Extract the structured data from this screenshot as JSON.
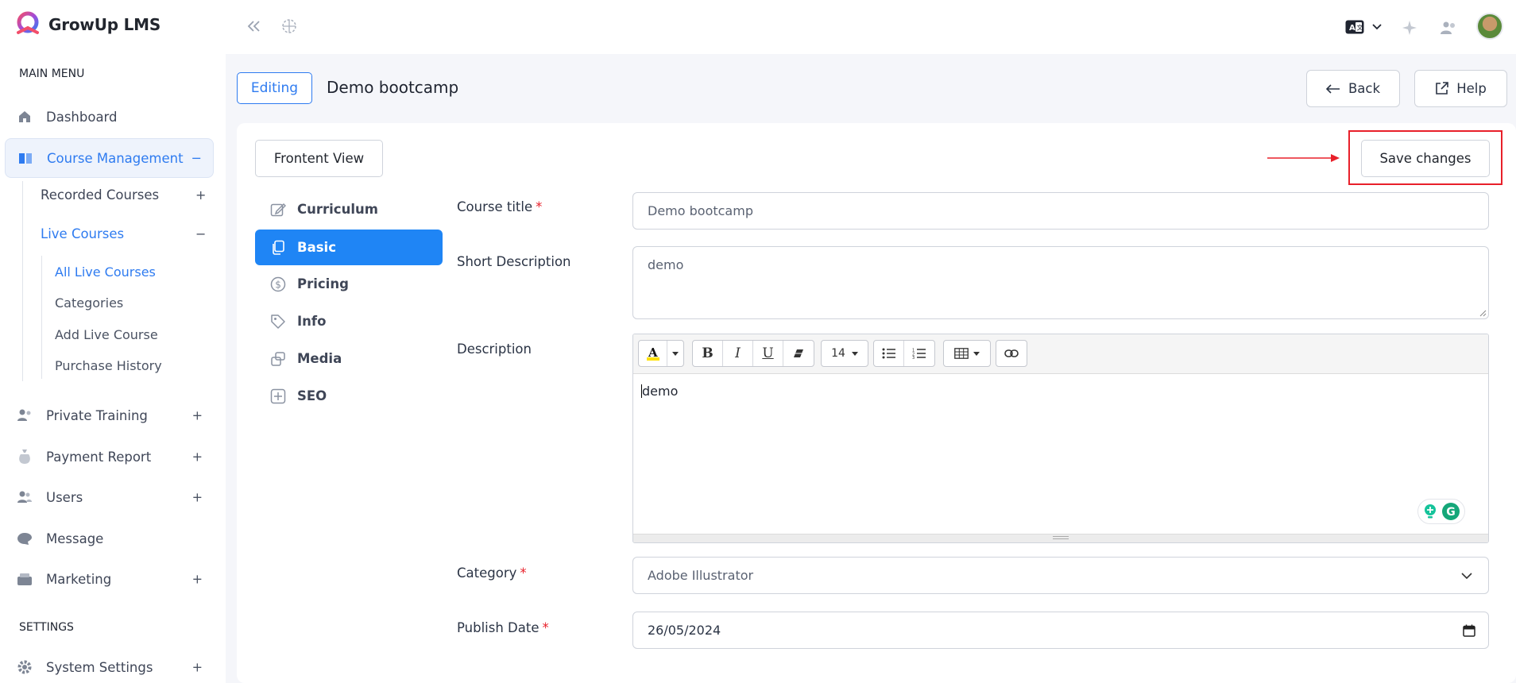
{
  "app": {
    "name": "GrowUp LMS"
  },
  "sidebar": {
    "main_menu_heading": "MAIN MENU",
    "settings_heading": "SETTINGS",
    "items": {
      "dashboard": {
        "label": "Dashboard"
      },
      "course_management": {
        "label": "Course Management",
        "toggle": "−"
      },
      "recorded_courses": {
        "label": "Recorded Courses",
        "toggle": "+"
      },
      "live_courses": {
        "label": "Live Courses",
        "toggle": "−"
      },
      "all_live_courses": {
        "label": "All Live Courses"
      },
      "categories": {
        "label": "Categories"
      },
      "add_live_course": {
        "label": "Add Live Course"
      },
      "purchase_history": {
        "label": "Purchase History"
      },
      "private_training": {
        "label": "Private Training",
        "toggle": "+"
      },
      "payment_report": {
        "label": "Payment Report",
        "toggle": "+"
      },
      "users": {
        "label": "Users",
        "toggle": "+"
      },
      "message": {
        "label": "Message"
      },
      "marketing": {
        "label": "Marketing",
        "toggle": "+"
      },
      "system_settings": {
        "label": "System Settings",
        "toggle": "+"
      }
    }
  },
  "header": {
    "badge": "Editing",
    "title": "Demo bootcamp",
    "back_label": "Back",
    "help_label": "Help"
  },
  "actions": {
    "frontend_view": "Frontent View",
    "save_changes": "Save changes"
  },
  "tabs": [
    {
      "label": "Curriculum",
      "icon": "edit-icon"
    },
    {
      "label": "Basic",
      "icon": "copy-icon"
    },
    {
      "label": "Pricing",
      "icon": "dollar-icon"
    },
    {
      "label": "Info",
      "icon": "tag-icon"
    },
    {
      "label": "Media",
      "icon": "media-icon"
    },
    {
      "label": "SEO",
      "icon": "seo-icon"
    }
  ],
  "form": {
    "course_title": {
      "label": "Course title",
      "required": "*",
      "value": "Demo bootcamp"
    },
    "short_description": {
      "label": "Short Description",
      "value": "demo"
    },
    "description": {
      "label": "Description",
      "value": "demo",
      "font_size": "14"
    },
    "category": {
      "label": "Category",
      "required": "*",
      "value": "Adobe Illustrator"
    },
    "publish_date": {
      "label": "Publish Date",
      "required": "*",
      "value": "26/05/2024"
    }
  },
  "colors": {
    "accent": "#2e7bf0",
    "active_tab": "#1f85f5",
    "highlight": "#e8202a"
  }
}
